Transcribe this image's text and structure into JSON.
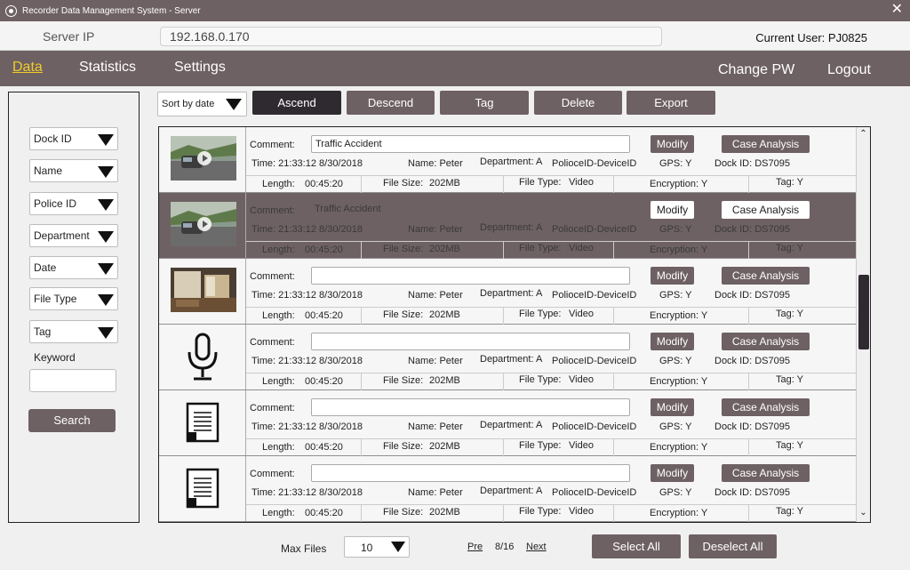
{
  "window": {
    "title": "Recorder Data Management System -  Server",
    "close": "✕"
  },
  "server": {
    "label": "Server IP",
    "ip": "192.168.0.170",
    "current_user": "Current User: PJ0825"
  },
  "nav": {
    "data": "Data",
    "statistics": "Statistics",
    "settings": "Settings",
    "change_pw": "Change PW",
    "logout": "Logout"
  },
  "filters": {
    "dock_id": "Dock ID",
    "name": "Name",
    "police_id": "Police ID",
    "department": "Department",
    "date": "Date",
    "file_type": "File Type",
    "tag": "Tag",
    "keyword_label": "Keyword",
    "search": "Search"
  },
  "toolbar": {
    "sort": "Sort by date",
    "ascend": "Ascend",
    "descend": "Descend",
    "tag": "Tag",
    "delete": "Delete",
    "export": "Export"
  },
  "row_labels": {
    "comment": "Comment:",
    "modify": "Modify",
    "case_analysis": "Case Analysis",
    "length": "Length:",
    "file_size": "File Size:",
    "file_type": "File Type:"
  },
  "records": [
    {
      "thumb": "video-street",
      "comment": "Traffic Accident",
      "time": "Time:  21:33:12 8/30/2018",
      "name": "Name: Peter",
      "department": "Department: A",
      "device": "PolioceID-DeviceID",
      "gps": "GPS: Y",
      "dock": "Dock ID: DS7095",
      "length": "00:45:20",
      "size": "202MB",
      "type": "Video",
      "encryption": "Encryption: Y",
      "tag": "Tag: Y"
    },
    {
      "thumb": "video-street",
      "comment": "Traffic Accident",
      "time": "Time:  21:33:12 8/30/2018",
      "name": "Name: Peter",
      "department": "Department: A",
      "device": "PolioceID-DeviceID",
      "gps": "GPS: Y",
      "dock": "Dock ID: DS7095",
      "length": "00:45:20",
      "size": "202MB",
      "type": "Video",
      "encryption": "Encryption: Y",
      "tag": "Tag: Y"
    },
    {
      "thumb": "photo-room",
      "comment": "",
      "time": "Time:  21:33:12 8/30/2018",
      "name": "Name: Peter",
      "department": "Department: A",
      "device": "PolioceID-DeviceID",
      "gps": "GPS: Y",
      "dock": "Dock ID: DS7095",
      "length": "00:45:20",
      "size": "202MB",
      "type": "Video",
      "encryption": "Encryption: Y",
      "tag": "Tag: Y"
    },
    {
      "thumb": "microphone-icon",
      "comment": "",
      "time": "Time:  21:33:12 8/30/2018",
      "name": "Name: Peter",
      "department": "Department: A",
      "device": "PolioceID-DeviceID",
      "gps": "GPS: Y",
      "dock": "Dock ID: DS7095",
      "length": "00:45:20",
      "size": "202MB",
      "type": "Video",
      "encryption": "Encryption: Y",
      "tag": "Tag: Y"
    },
    {
      "thumb": "document-icon",
      "comment": "",
      "time": "Time:  21:33:12 8/30/2018",
      "name": "Name: Peter",
      "department": "Department: A",
      "device": "PolioceID-DeviceID",
      "gps": "GPS: Y",
      "dock": "Dock ID: DS7095",
      "length": "00:45:20",
      "size": "202MB",
      "type": "Video",
      "encryption": "Encryption: Y",
      "tag": "Tag: Y"
    },
    {
      "thumb": "document-icon",
      "comment": "",
      "time": "Time:  21:33:12 8/30/2018",
      "name": "Name: Peter",
      "department": "Department: A",
      "device": "PolioceID-DeviceID",
      "gps": "GPS: Y",
      "dock": "Dock ID: DS7095",
      "length": "00:45:20",
      "size": "202MB",
      "type": "Video",
      "encryption": "Encryption: Y",
      "tag": "Tag: Y"
    }
  ],
  "selected_record": 1,
  "footer": {
    "max_files_label": "Max Files",
    "max_files_value": "10",
    "pre": "Pre",
    "page": "8/16",
    "next": "Next",
    "select_all": "Select All",
    "deselect_all": "Deselect All"
  }
}
